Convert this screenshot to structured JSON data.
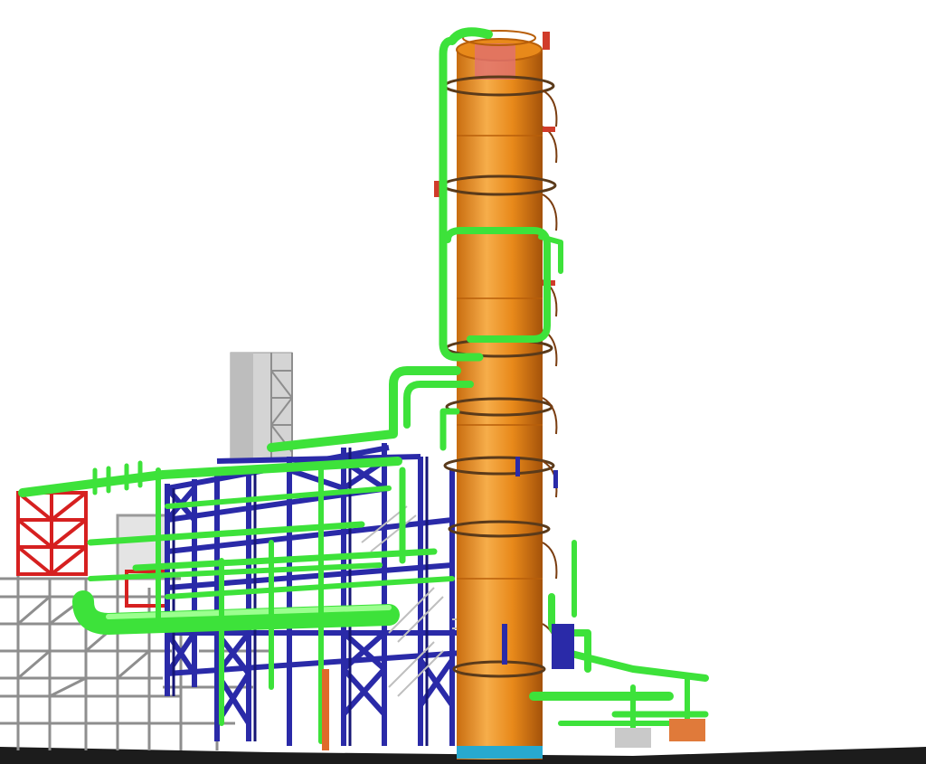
{
  "colors": {
    "background": "#ffffff",
    "column_body": "#e8891a",
    "column_light": "#f6ad4a",
    "column_dark": "#b85f0a",
    "pipe": "#3de23a",
    "pipe_dark": "#1f9c1f",
    "steel_blue": "#2a2aa8",
    "steel_blue_dark": "#151575",
    "steel_red": "#d62020",
    "steel_grey": "#c9c9c9",
    "steel_grey_dark": "#8e8e8e",
    "tower_grey": "#d4d4d4",
    "ground": "#1c1c1c",
    "base_ring": "#27a9cf"
  },
  "components": [
    {
      "name": "distillation-column",
      "color_key": "column_body"
    },
    {
      "name": "process-piping",
      "color_key": "pipe"
    },
    {
      "name": "blue-pipe-rack",
      "color_key": "steel_blue"
    },
    {
      "name": "red-frame",
      "color_key": "steel_red"
    },
    {
      "name": "grey-structure",
      "color_key": "steel_grey"
    },
    {
      "name": "grey-tower",
      "color_key": "tower_grey"
    },
    {
      "name": "ground-slab",
      "color_key": "ground"
    }
  ]
}
